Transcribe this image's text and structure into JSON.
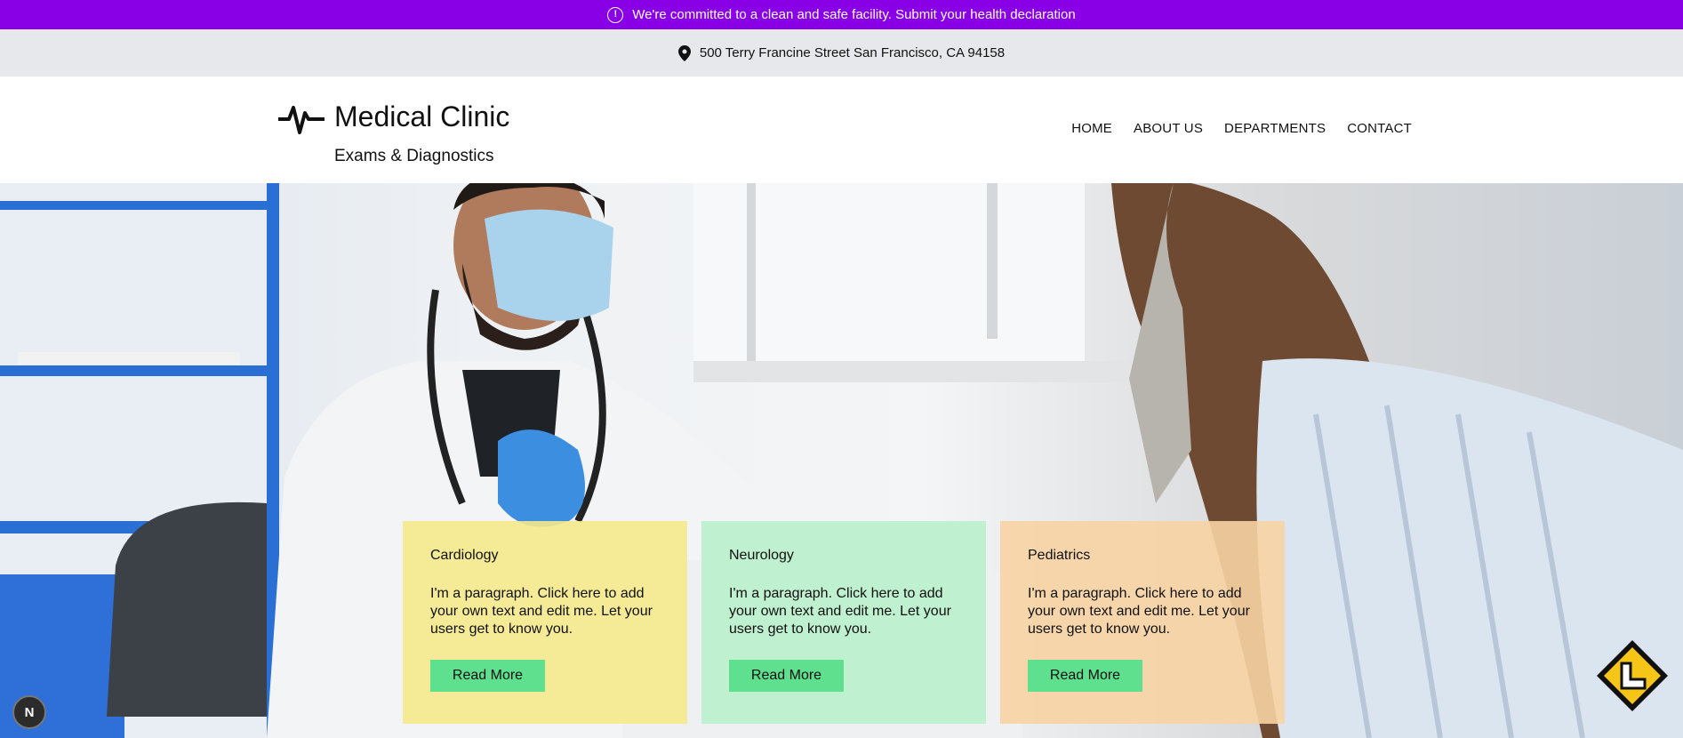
{
  "announcement": {
    "text": "We're committed to a clean and safe facility. Submit your health declaration",
    "icon": "alert-circle-icon"
  },
  "address": {
    "text": "500 Terry Francine Street San Francisco, CA 94158",
    "icon": "location-pin-icon"
  },
  "brand": {
    "title": "Medical Clinic",
    "subtitle": "Exams & Diagnostics",
    "icon": "heartbeat-icon"
  },
  "nav": {
    "items": [
      {
        "label": "HOME"
      },
      {
        "label": "ABOUT US"
      },
      {
        "label": "DEPARTMENTS"
      },
      {
        "label": "CONTACT"
      }
    ]
  },
  "cards": [
    {
      "title": "Cardiology",
      "text": "I'm a paragraph. Click here to add your own text and edit me. Let your users get to know you.",
      "button": "Read More",
      "color": "#f5e98c"
    },
    {
      "title": "Neurology",
      "text": "I'm a paragraph. Click here to add your own text and edit me. Let your users get to know you.",
      "button": "Read More",
      "color": "#b9f0cc"
    },
    {
      "title": "Pediatrics",
      "text": "I'm a paragraph. Click here to add your own text and edit me. Let your users get to know you.",
      "button": "Read More",
      "color": "#f7d3a3"
    }
  ],
  "colors": {
    "announcement_bg": "#8a00e6",
    "button_bg": "#5fe08e",
    "address_bg": "#e7e8ec"
  },
  "floating": {
    "left_badge": "N"
  }
}
